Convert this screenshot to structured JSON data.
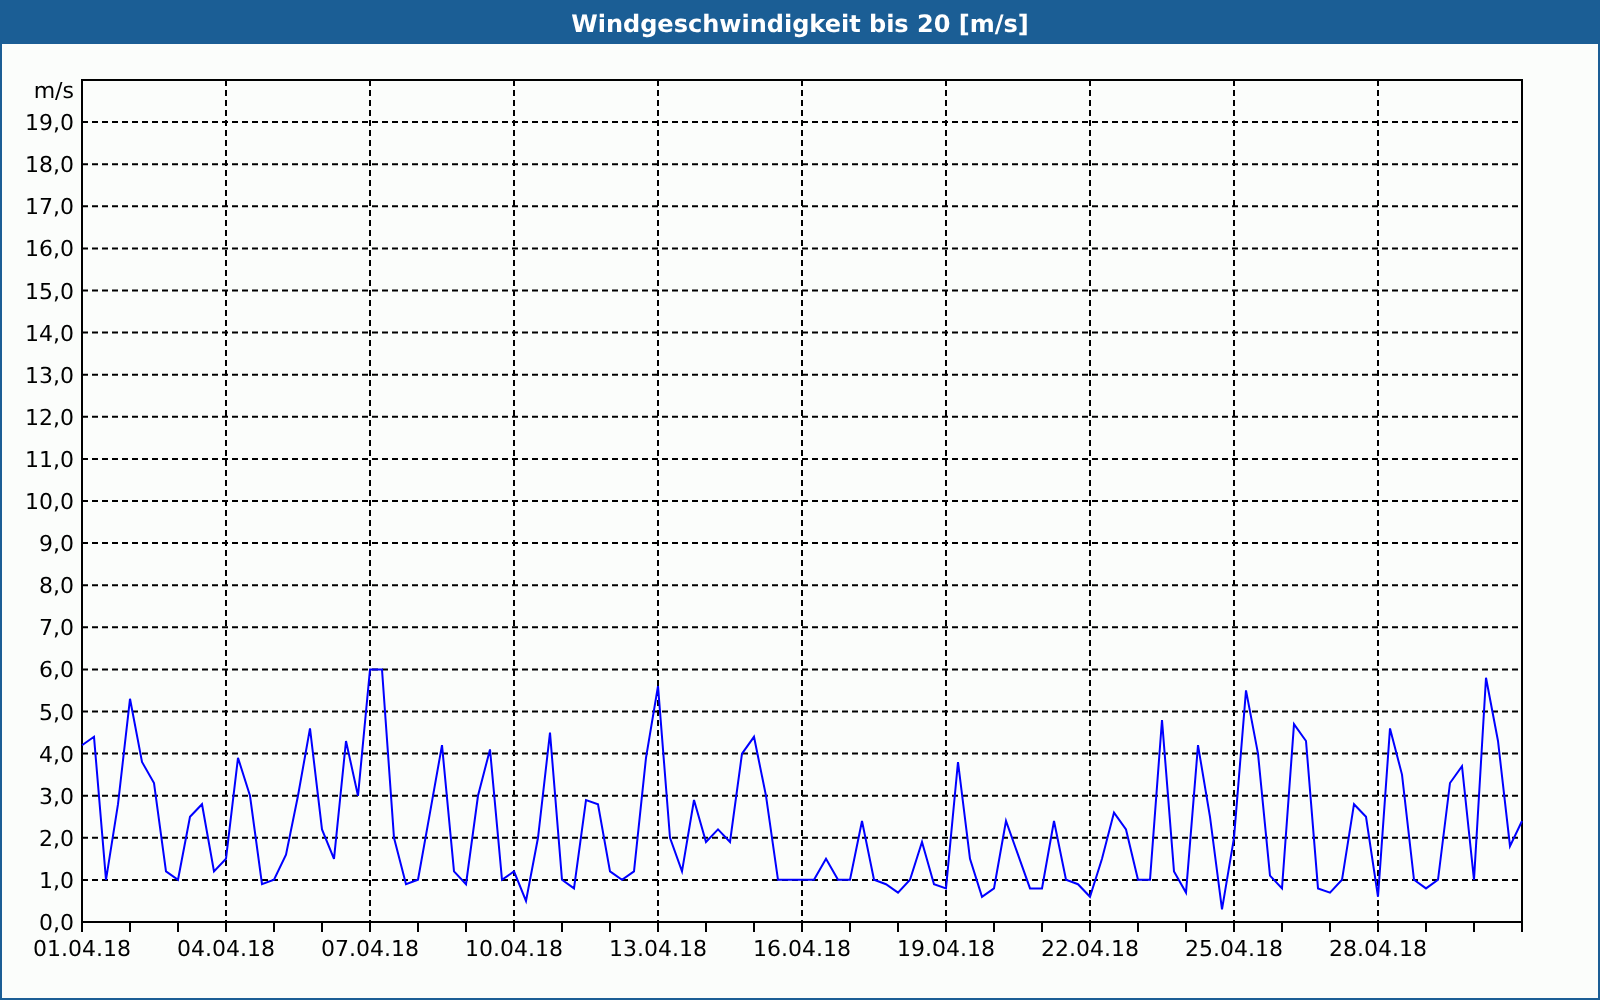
{
  "window": {
    "title": "Windgeschwindigkeit bis 20 [m/s]"
  },
  "chart": {
    "unit": "m/s",
    "chart_data": {
      "type": "line",
      "grid": true,
      "ylim": [
        0,
        20
      ],
      "categories": [
        "01.04.18",
        null,
        null,
        null,
        null,
        null,
        null,
        null,
        null,
        null,
        null,
        null,
        "04.04.18",
        null,
        null,
        null,
        null,
        null,
        null,
        null,
        null,
        null,
        null,
        null,
        "07.04.18",
        null,
        null,
        null,
        null,
        null,
        null,
        null,
        null,
        null,
        null,
        null,
        "10.04.18",
        null,
        null,
        null,
        null,
        null,
        null,
        null,
        null,
        null,
        null,
        null,
        "13.04.18",
        null,
        null,
        null,
        null,
        null,
        null,
        null,
        null,
        null,
        null,
        null,
        "16.04.18",
        null,
        null,
        null,
        null,
        null,
        null,
        null,
        null,
        null,
        null,
        null,
        "19.04.18",
        null,
        null,
        null,
        null,
        null,
        null,
        null,
        null,
        null,
        null,
        null,
        "22.04.18",
        null,
        null,
        null,
        null,
        null,
        null,
        null,
        null,
        null,
        null,
        null,
        "25.04.18",
        null,
        null,
        null,
        null,
        null,
        null,
        null,
        null,
        null,
        null,
        null,
        "28.04.18",
        null,
        null,
        null,
        null,
        null,
        null,
        null,
        null,
        null,
        null,
        null,
        null
      ],
      "yticks": [
        {
          "value": 0,
          "label": "0,0"
        },
        {
          "value": 1,
          "label": "1,0"
        },
        {
          "value": 2,
          "label": "2,0"
        },
        {
          "value": 3,
          "label": "3,0"
        },
        {
          "value": 4,
          "label": "4,0"
        },
        {
          "value": 5,
          "label": "5,0"
        },
        {
          "value": 6,
          "label": "6,0"
        },
        {
          "value": 7,
          "label": "7,0"
        },
        {
          "value": 8,
          "label": "8,0"
        },
        {
          "value": 9,
          "label": "9,0"
        },
        {
          "value": 10,
          "label": "10,0"
        },
        {
          "value": 11,
          "label": "11,0"
        },
        {
          "value": 12,
          "label": "12,0"
        },
        {
          "value": 13,
          "label": "13,0"
        },
        {
          "value": 14,
          "label": "14,0"
        },
        {
          "value": 15,
          "label": "15,0"
        },
        {
          "value": 16,
          "label": "16,0"
        },
        {
          "value": 17,
          "label": "17,0"
        },
        {
          "value": 18,
          "label": "18,0"
        },
        {
          "value": 19,
          "label": "19,0"
        }
      ],
      "series": [
        {
          "color": "#0000ff",
          "values": [
            4.2,
            4.4,
            1.0,
            2.8,
            5.3,
            3.8,
            3.3,
            1.2,
            1.0,
            2.5,
            2.8,
            1.2,
            1.5,
            3.9,
            3.0,
            0.9,
            1.0,
            1.6,
            3.0,
            4.6,
            2.2,
            1.5,
            4.3,
            3.0,
            6.0,
            6.0,
            2.0,
            0.9,
            1.0,
            2.6,
            4.2,
            1.2,
            0.9,
            3.0,
            4.1,
            1.0,
            1.2,
            0.5,
            2.0,
            4.5,
            1.0,
            0.8,
            2.9,
            2.8,
            1.2,
            1.0,
            1.2,
            3.9,
            5.6,
            2.0,
            1.2,
            2.9,
            1.9,
            2.2,
            1.9,
            4.0,
            4.4,
            3.0,
            1.0,
            1.0,
            1.0,
            1.0,
            1.5,
            1.0,
            1.0,
            2.4,
            1.0,
            0.9,
            0.7,
            1.0,
            1.9,
            0.9,
            0.8,
            3.8,
            1.5,
            0.6,
            0.8,
            2.4,
            1.6,
            0.8,
            0.8,
            2.4,
            1.0,
            0.9,
            0.6,
            1.5,
            2.6,
            2.2,
            1.0,
            1.0,
            4.8,
            1.2,
            0.7,
            4.2,
            2.5,
            0.3,
            2.0,
            5.5,
            4.0,
            1.1,
            0.8,
            4.7,
            4.3,
            0.8,
            0.7,
            1.0,
            2.8,
            2.5,
            0.6,
            4.6,
            3.5,
            1.0,
            0.8,
            1.0,
            3.3,
            3.7,
            1.0,
            5.8,
            4.3,
            1.8,
            2.4
          ]
        }
      ]
    }
  }
}
